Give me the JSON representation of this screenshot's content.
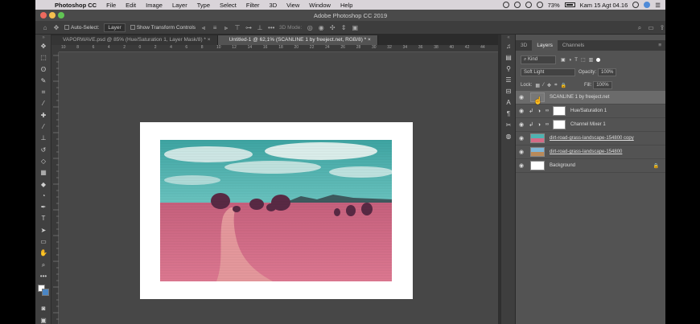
{
  "menubar": {
    "items": [
      "Photoshop CC",
      "File",
      "Edit",
      "Image",
      "Layer",
      "Type",
      "Select",
      "Filter",
      "3D",
      "View",
      "Window",
      "Help"
    ],
    "battery": "73%",
    "clock": "Kam 15 Agt 04.16"
  },
  "window": {
    "title": "Adobe Photoshop CC 2019"
  },
  "options": {
    "auto_select_label": "Auto-Select:",
    "auto_select_value": "Layer",
    "transform_controls_label": "Show Transform Controls",
    "mode_3d_label": "3D Mode:"
  },
  "doc_tabs": [
    {
      "label": "VAPORWAVE.psd @ 85% (Hue/Saturation 1, Layer Mask/8) *",
      "close": "×"
    },
    {
      "label": "Untitled-1 @ 62,1% (SCANLINE 1 by freeject.net, RGB/8) *",
      "close": "×"
    }
  ],
  "ruler_ticks": [
    "10",
    "8",
    "6",
    "4",
    "2",
    "0",
    "2",
    "4",
    "6",
    "8",
    "10",
    "12",
    "14",
    "16",
    "18",
    "20",
    "22",
    "24",
    "26",
    "28",
    "30",
    "32",
    "34",
    "36",
    "38",
    "40",
    "42",
    "44"
  ],
  "panel": {
    "tabs": [
      "3D",
      "Layers",
      "Channels"
    ],
    "active_tab": "Layers",
    "filter_kind": "Kind",
    "blend_mode": "Soft Light",
    "opacity_label": "Opacity:",
    "opacity_value": "100%",
    "lock_label": "Lock:",
    "fill_label": "Fill:",
    "fill_value": "100%"
  },
  "layers": [
    {
      "name": "SCANLINE 1 by freeject.net",
      "selected": true
    },
    {
      "name": "Hue/Saturation 1",
      "selected": false
    },
    {
      "name": "Channel Mixer 1",
      "selected": false
    },
    {
      "name": "dirt-road-grass-landscape-154800 copy",
      "selected": false
    },
    {
      "name": "dirt-road-grass-landscape-154800",
      "selected": false
    },
    {
      "name": "Background",
      "selected": false
    }
  ],
  "colors": {
    "sky": "#4fb3b1",
    "field": "#d46a86",
    "accent": "#4f8bd8"
  }
}
